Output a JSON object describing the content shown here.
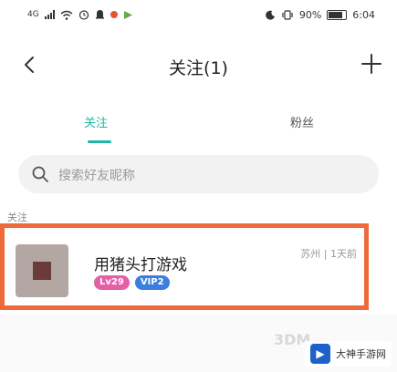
{
  "status_bar": {
    "carrier_indicator": "4G",
    "battery_percent": "90%",
    "time": "6:04"
  },
  "header": {
    "title": "关注(1)"
  },
  "tabs": [
    {
      "label": "关注",
      "active": true
    },
    {
      "label": "粉丝",
      "active": false
    }
  ],
  "search": {
    "placeholder": "搜索好友昵称"
  },
  "section": {
    "label": "关注"
  },
  "users": [
    {
      "name": "用猪头打游戏",
      "level_badge": "Lv29",
      "vip_badge": "VIP2",
      "meta": "苏州 | 1天前"
    }
  ],
  "footer": {
    "watermark": "3DM",
    "brand_label": "大神手游网"
  },
  "colors": {
    "accent": "#1fb7a6",
    "highlight_border": "#ee6a3b",
    "level_badge": "#e45fa6",
    "vip_badge": "#3a7fe0"
  }
}
